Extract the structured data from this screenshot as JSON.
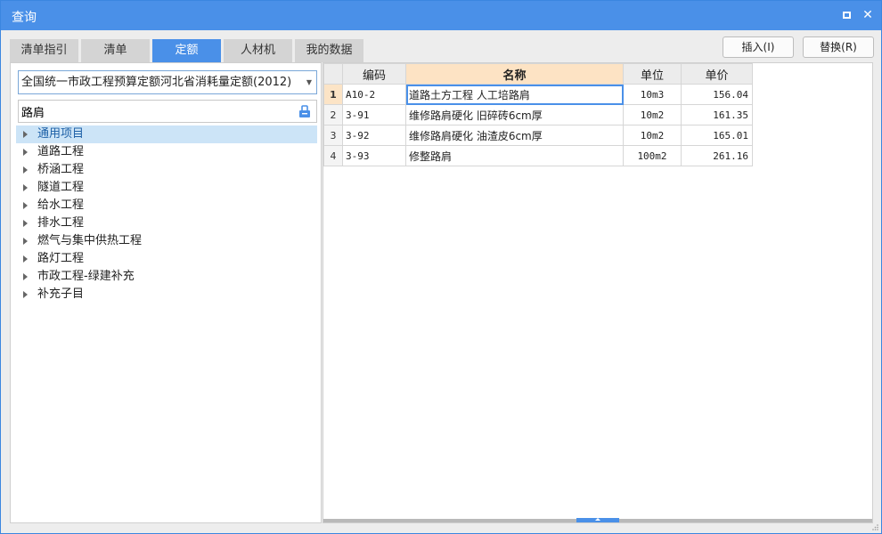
{
  "window": {
    "title": "查询",
    "maximize_icon": "maximize-icon",
    "close_icon": "close-icon",
    "close_glyph": "✕"
  },
  "tabs": [
    {
      "label": "清单指引",
      "active": false
    },
    {
      "label": "清单",
      "active": false
    },
    {
      "label": "定额",
      "active": true
    },
    {
      "label": "人材机",
      "active": false
    },
    {
      "label": "我的数据",
      "active": false
    }
  ],
  "actions": {
    "insert_label": "插入(I)",
    "replace_label": "替换(R)"
  },
  "left": {
    "quota_library": "全国统一市政工程预算定额河北省消耗量定额(2012)",
    "search_value": "路肩",
    "search_icon": "search-icon",
    "tree": [
      {
        "label": "通用项目",
        "selected": true
      },
      {
        "label": "道路工程",
        "selected": false
      },
      {
        "label": "桥涵工程",
        "selected": false
      },
      {
        "label": "隧道工程",
        "selected": false
      },
      {
        "label": "给水工程",
        "selected": false
      },
      {
        "label": "排水工程",
        "selected": false
      },
      {
        "label": "燃气与集中供热工程",
        "selected": false
      },
      {
        "label": "路灯工程",
        "selected": false
      },
      {
        "label": "市政工程-绿建补充",
        "selected": false
      },
      {
        "label": "补充子目",
        "selected": false
      }
    ]
  },
  "grid": {
    "columns": [
      "编码",
      "名称",
      "单位",
      "单价"
    ],
    "rows": [
      {
        "no": "1",
        "code": "A10-2",
        "name": "道路土方工程 人工培路肩",
        "unit": "10m3",
        "price": "156.04"
      },
      {
        "no": "2",
        "code": "3-91",
        "name": "维修路肩硬化 旧碎砖6cm厚",
        "unit": "10m2",
        "price": "161.35"
      },
      {
        "no": "3",
        "code": "3-92",
        "name": "维修路肩硬化 油渣皮6cm厚",
        "unit": "10m2",
        "price": "165.01"
      },
      {
        "no": "4",
        "code": "3-93",
        "name": "修整路肩",
        "unit": "100m2",
        "price": "261.16"
      }
    ]
  },
  "colors": {
    "accent": "#4a90e8",
    "header_highlight": "#fde3c4",
    "tree_selected": "#cce4f7"
  }
}
